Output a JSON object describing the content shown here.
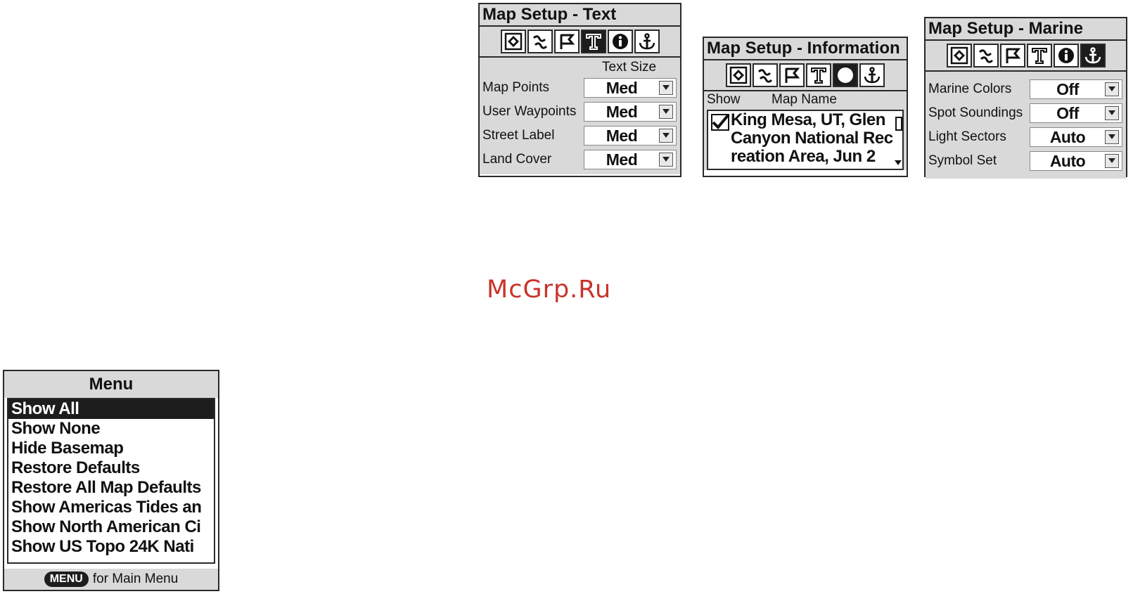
{
  "watermark": "McGrp.Ru",
  "text_panel": {
    "title": "Map Setup - Text",
    "column_header": "Text Size",
    "rows": [
      {
        "label": "Map Points",
        "value": "Med"
      },
      {
        "label": "User Waypoints",
        "value": "Med"
      },
      {
        "label": "Street Label",
        "value": "Med"
      },
      {
        "label": "Land Cover",
        "value": "Med"
      }
    ]
  },
  "info_panel": {
    "title": "Map Setup - Information",
    "column_show": "Show",
    "column_name": "Map Name",
    "map_lines": [
      "King Mesa, UT, Glen",
      "Canyon National Rec",
      "reation Area, Jun 2"
    ]
  },
  "marine_panel": {
    "title": "Map Setup - Marine",
    "rows": [
      {
        "label": "Marine Colors",
        "value": "Off"
      },
      {
        "label": "Spot Soundings",
        "value": "Off"
      },
      {
        "label": "Light Sectors",
        "value": "Auto"
      },
      {
        "label": "Symbol Set",
        "value": "Auto"
      }
    ]
  },
  "menu_panel": {
    "title": "Menu",
    "items": [
      "Show All",
      "Show None",
      "Hide Basemap",
      "Restore Defaults",
      "Restore All Map Defaults",
      "Show Americas Tides an",
      "Show North American Ci",
      "Show US Topo 24K Nati"
    ],
    "footer_key": "MENU",
    "footer_text": "for Main Menu"
  },
  "tab_icons": [
    "general-map-icon",
    "tracks-icon",
    "points-flag-icon",
    "text-icon",
    "information-icon",
    "marine-anchor-icon"
  ],
  "colors": {
    "panel_gray": "#d9d9d9",
    "highlight": "#1d1d1d",
    "watermark": "#c8342a"
  }
}
